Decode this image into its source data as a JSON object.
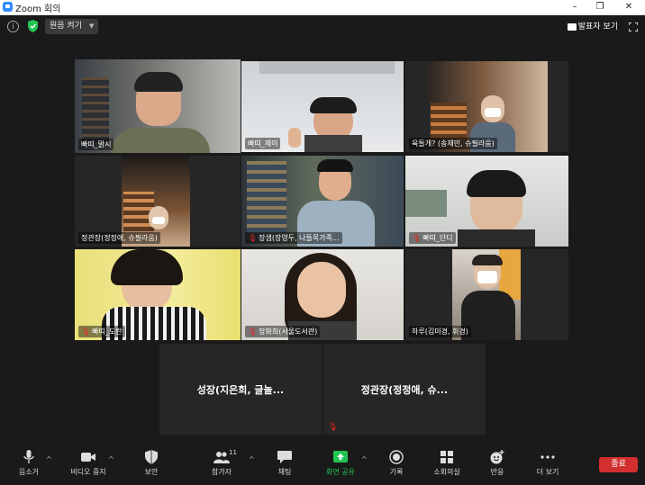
{
  "window": {
    "title": "Zoom 회의",
    "min_label": "–",
    "restore_label": "❐",
    "close_label": "✕"
  },
  "topbar": {
    "info_label": "i",
    "original_sound": "원음 켜기",
    "speaker_view": "발표자 보기"
  },
  "participants": [
    {
      "name": "빠띠_맑시",
      "active": true,
      "muted": false
    },
    {
      "name": "빠띠_제이",
      "active": false,
      "muted": false
    },
    {
      "name": "육들개? (송재민, 슈필라움)",
      "active": false,
      "muted": false
    },
    {
      "name": "정관장(정정애, 슈필라움)",
      "active": false,
      "muted": false
    },
    {
      "name": "장샘(장영두, 나들목가족...",
      "active": false,
      "muted": true
    },
    {
      "name": "빠띠_단디",
      "active": false,
      "muted": true
    },
    {
      "name": "빠띠_도란",
      "active": false,
      "muted": true
    },
    {
      "name": "장화희(서울도서관)",
      "active": false,
      "muted": true
    },
    {
      "name": "하루(김미경, 휘경)",
      "active": false,
      "muted": false
    },
    {
      "name": "성장(지은희, 글놀...",
      "active": false,
      "muted": false,
      "video_off": true
    },
    {
      "name": "정관장(정정애, 슈...",
      "active": false,
      "muted": true,
      "video_off": true
    }
  ],
  "toolbar": {
    "mute": "음소거",
    "stop_video": "비디오 중지",
    "security": "보안",
    "participants": "참가자",
    "participants_count": "11",
    "chat": "채팅",
    "share_screen": "화면 공유",
    "record": "기록",
    "breakout": "소회의실",
    "reactions": "반응",
    "more": "더 보기",
    "end": "종료",
    "caret": "^"
  },
  "colors": {
    "active_speaker": "#c7e35a",
    "share_green": "#23c552",
    "end_red": "#d32f2f",
    "muted_red": "#e22222"
  }
}
